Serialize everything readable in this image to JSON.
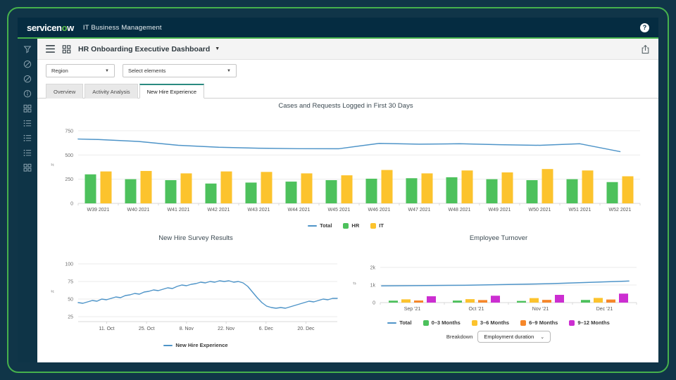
{
  "colors": {
    "brand_green": "#46b14c",
    "header_bg": "#052c41",
    "sidebar_bg": "#0e3447",
    "accent_teal": "#2a8a80",
    "line_blue": "#4e94c8"
  },
  "header": {
    "logo_part1": "servicen",
    "logo_part2": "o",
    "logo_part3": "w",
    "product": "IT Business Management",
    "help_label": "?"
  },
  "sidebar": {
    "icons": [
      {
        "name": "filter-icon"
      },
      {
        "name": "gauge-icon"
      },
      {
        "name": "gauge-icon"
      },
      {
        "name": "info-icon"
      },
      {
        "name": "grid-icon"
      },
      {
        "name": "list-icon"
      },
      {
        "name": "list-icon"
      },
      {
        "name": "list-icon"
      },
      {
        "name": "grid-icon"
      }
    ]
  },
  "toolbar": {
    "title": "HR Onboarding Executive Dashboard"
  },
  "filters": {
    "region_value": "Region",
    "elements_placeholder": "Select elements"
  },
  "tabs": [
    {
      "label": "Overview",
      "active": false
    },
    {
      "label": "Activity Analysis",
      "active": false
    },
    {
      "label": "New Hire Experience",
      "active": true
    }
  ],
  "chart_data": [
    {
      "type": "bar",
      "title": "Cases and Requests Logged in First 30 Days",
      "categories": [
        "W39 2021",
        "W40 2021",
        "W41 2021",
        "W42 2021",
        "W43 2021",
        "W44 2021",
        "W45 2021",
        "W46 2021",
        "W47 2021",
        "W48 2021",
        "W49 2021",
        "W50 2021",
        "W51 2021",
        "W52 2021"
      ],
      "series": [
        {
          "name": "HR",
          "color": "#4dc15c",
          "values": [
            300,
            250,
            240,
            205,
            215,
            225,
            240,
            255,
            260,
            270,
            250,
            240,
            250,
            220
          ]
        },
        {
          "name": "IT",
          "color": "#fcc32d",
          "values": [
            330,
            335,
            310,
            330,
            325,
            310,
            290,
            345,
            310,
            340,
            320,
            355,
            340,
            280
          ]
        }
      ],
      "line": {
        "name": "Total",
        "color": "#4e94c8",
        "edge_start": 665,
        "values": [
          660,
          640,
          600,
          580,
          570,
          565,
          565,
          620,
          612,
          616,
          606,
          600,
          616,
          535
        ]
      },
      "ylim": [
        0,
        800
      ],
      "yticks": [
        {
          "v": 0,
          "label": "0"
        },
        {
          "v": 250,
          "label": "250"
        },
        {
          "v": 500,
          "label": "500"
        },
        {
          "v": 750,
          "label": "750"
        }
      ],
      "yaxis_label": "#",
      "legend": [
        {
          "label": "Total",
          "type": "line",
          "color": "#4e94c8"
        },
        {
          "label": "HR",
          "type": "box",
          "color": "#4dc15c"
        },
        {
          "label": "IT",
          "type": "box",
          "color": "#fcc32d"
        }
      ]
    },
    {
      "type": "line",
      "title": "New Hire Survey Results",
      "color": "#4e94c8",
      "values": [
        45,
        44,
        46,
        48,
        47,
        50,
        49,
        51,
        53,
        52,
        55,
        56,
        58,
        57,
        60,
        61,
        63,
        62,
        64,
        66,
        65,
        68,
        70,
        69,
        71,
        72,
        74,
        73,
        75,
        74,
        76,
        75,
        76,
        74,
        75,
        73,
        68,
        60,
        52,
        45,
        40,
        38,
        37,
        38,
        37,
        39,
        41,
        43,
        45,
        47,
        46,
        48,
        50,
        49,
        51,
        51
      ],
      "ylim": [
        18,
        104
      ],
      "yticks": [
        {
          "v": 25,
          "label": "25"
        },
        {
          "v": 50,
          "label": "50"
        },
        {
          "v": 75,
          "label": "75"
        },
        {
          "v": 100,
          "label": "100"
        }
      ],
      "xticks": [
        {
          "frac": 0.11,
          "label": "11. Oct"
        },
        {
          "frac": 0.264,
          "label": "25. Oct"
        },
        {
          "frac": 0.418,
          "label": "8. Nov"
        },
        {
          "frac": 0.571,
          "label": "22. Nov"
        },
        {
          "frac": 0.725,
          "label": "6. Dec"
        },
        {
          "frac": 0.879,
          "label": "20. Dec"
        }
      ],
      "yaxis_label": "#",
      "legend": [
        {
          "label": "New Hire Experience",
          "type": "line",
          "color": "#4e94c8"
        }
      ]
    },
    {
      "type": "bar",
      "title": "Employee Turnover",
      "categories": [
        "Sep '21",
        "Oct '21",
        "Nov '21",
        "Dec '21"
      ],
      "series": [
        {
          "name": "0–3 Months",
          "color": "#4dc15c",
          "values": [
            110,
            115,
            95,
            150
          ]
        },
        {
          "name": "3–6 Months",
          "color": "#fcc32d",
          "values": [
            185,
            195,
            255,
            265
          ]
        },
        {
          "name": "6–9 Months",
          "color": "#f6872a",
          "values": [
            120,
            145,
            155,
            175
          ]
        },
        {
          "name": "9–12 Months",
          "color": "#cc2ed1",
          "values": [
            360,
            390,
            440,
            510
          ]
        }
      ],
      "line": {
        "name": "Total",
        "color": "#4e94c8",
        "x_fracs": [
          0.005,
          0.33,
          0.66,
          0.97
        ],
        "values": [
          950,
          985,
          1075,
          1225
        ]
      },
      "ylim": [
        0,
        2200
      ],
      "yticks": [
        {
          "v": 0,
          "label": "0"
        },
        {
          "v": 1000,
          "label": "1k"
        },
        {
          "v": 2000,
          "label": "2k"
        }
      ],
      "yaxis_label": "#",
      "legend": [
        {
          "label": "Total",
          "type": "line",
          "color": "#4e94c8"
        },
        {
          "label": "0–3 Months",
          "type": "box",
          "color": "#4dc15c"
        },
        {
          "label": "3–6 Months",
          "type": "box",
          "color": "#fcc32d"
        },
        {
          "label": "6–9 Months",
          "type": "box",
          "color": "#f6872a"
        },
        {
          "label": "9–12 Months",
          "type": "box",
          "color": "#cc2ed1"
        }
      ]
    }
  ],
  "breakdown": {
    "label": "Breakdown",
    "value": "Employment duration"
  }
}
